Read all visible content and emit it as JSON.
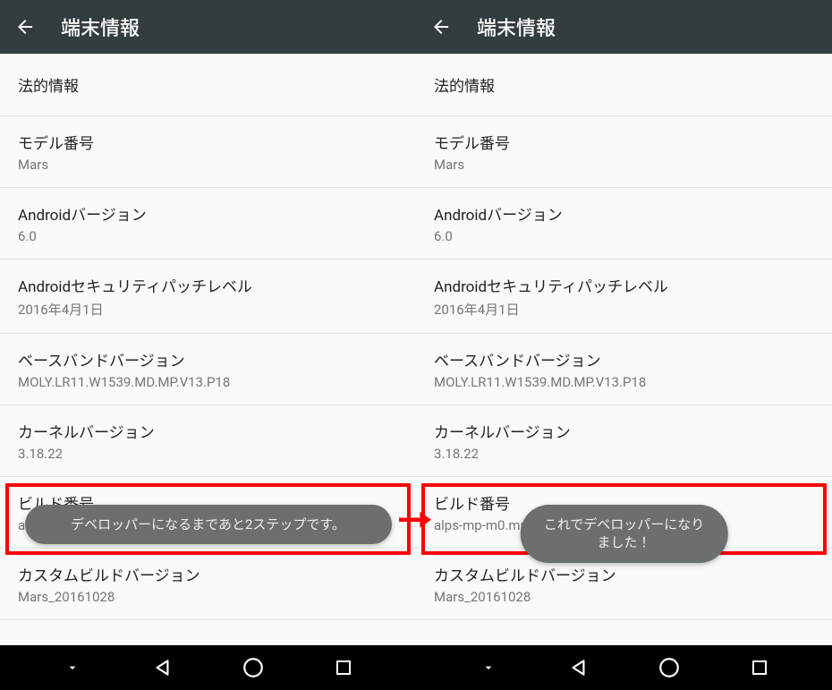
{
  "panels": [
    {
      "header": {
        "title": "端末情報"
      },
      "rows": {
        "legal": {
          "label": "法的情報"
        },
        "model": {
          "label": "モデル番号",
          "value": "Mars"
        },
        "android_version": {
          "label": "Androidバージョン",
          "value": "6.0"
        },
        "security_patch": {
          "label": "Androidセキュリティパッチレベル",
          "value": "2016年4月1日"
        },
        "baseband": {
          "label": "ベースバンドバージョン",
          "value": "MOLY.LR11.W1539.MD.MP.V13.P18"
        },
        "kernel": {
          "label": "カーネルバージョン",
          "value": "3.18.22"
        },
        "build": {
          "label": "ビルド番号",
          "value": "alps-mp-m0.mp7-V1.18_nb6735.66.m_P16"
        },
        "custom": {
          "label": "カスタムビルドバージョン",
          "value": "Mars_20161028"
        }
      },
      "toast": "デベロッパーになるまであと2ステップです。"
    },
    {
      "header": {
        "title": "端末情報"
      },
      "rows": {
        "legal": {
          "label": "法的情報"
        },
        "model": {
          "label": "モデル番号",
          "value": "Mars"
        },
        "android_version": {
          "label": "Androidバージョン",
          "value": "6.0"
        },
        "security_patch": {
          "label": "Androidセキュリティパッチレベル",
          "value": "2016年4月1日"
        },
        "baseband": {
          "label": "ベースバンドバージョン",
          "value": "MOLY.LR11.W1539.MD.MP.V13.P18"
        },
        "kernel": {
          "label": "カーネルバージョン",
          "value": "3.18.22"
        },
        "build": {
          "label": "ビルド番号",
          "value": "alps-mp-m0.mp7-V1.18_nb6735.66.m_P16"
        },
        "custom": {
          "label": "カスタムビルドバージョン",
          "value": "Mars_20161028"
        }
      },
      "toast": "これでデベロッパーになりました！"
    }
  ]
}
